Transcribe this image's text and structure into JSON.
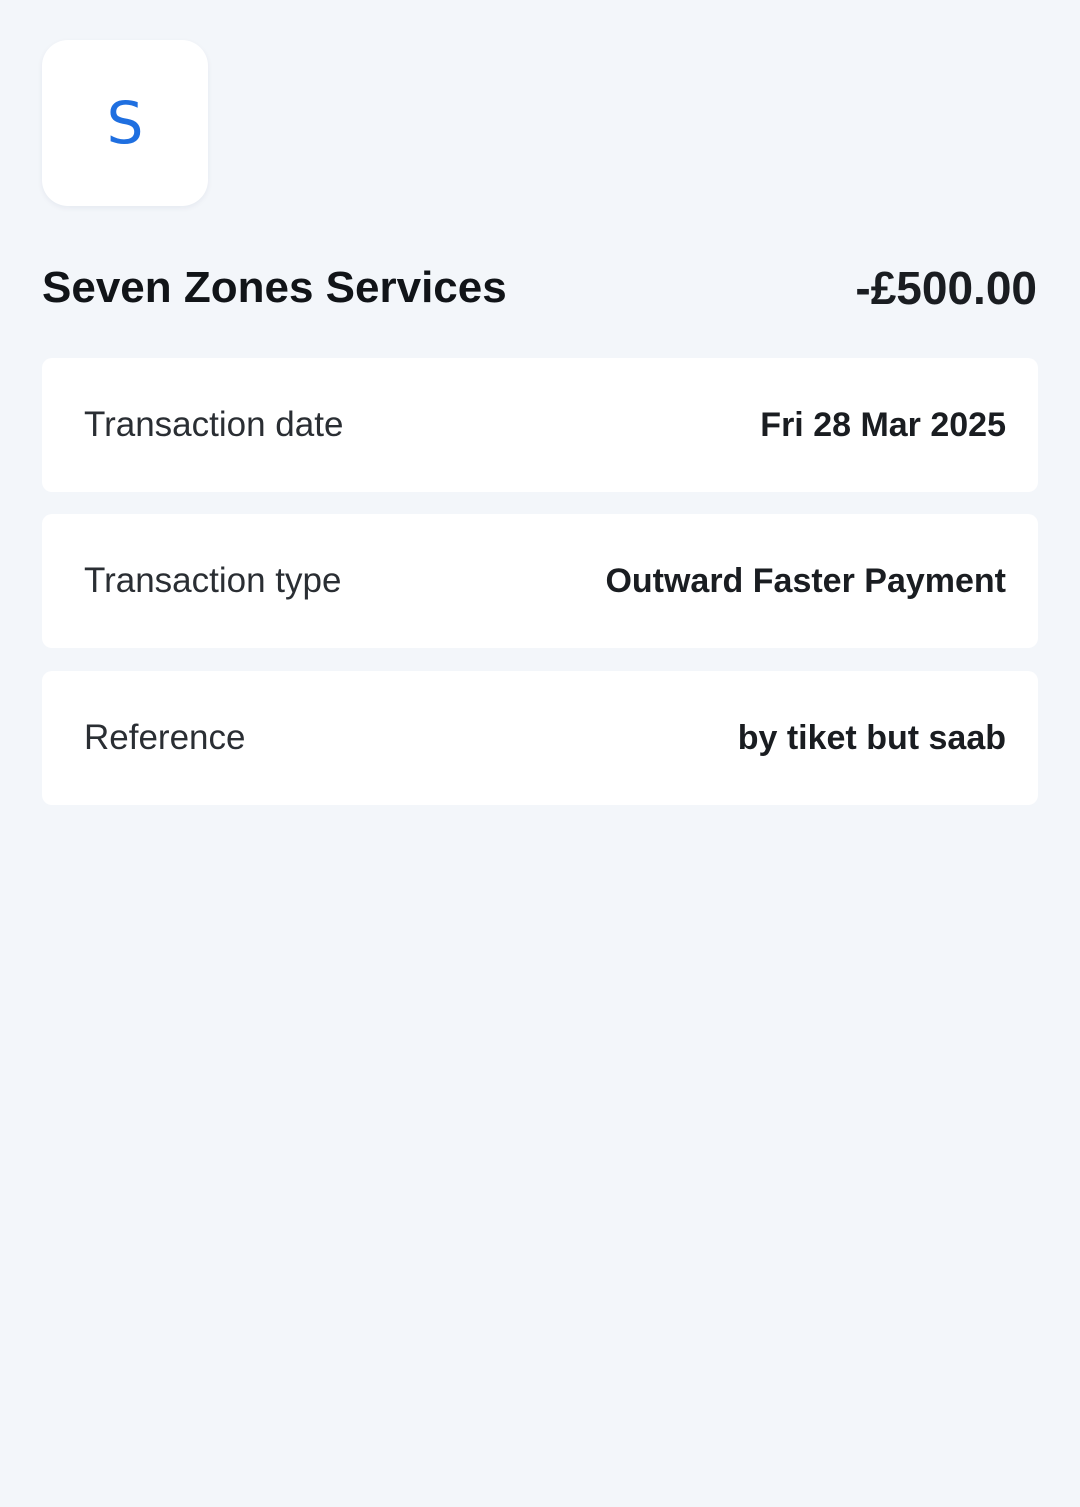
{
  "merchant": {
    "initial": "S",
    "name": "Seven Zones Services",
    "amount": "-£500.00"
  },
  "details": [
    {
      "label": "Transaction date",
      "value": "Fri 28 Mar 2025"
    },
    {
      "label": "Transaction type",
      "value": "Outward Faster Payment"
    },
    {
      "label": "Reference",
      "value": "by tiket but saab"
    }
  ],
  "colors": {
    "background": "#f3f6fa",
    "card": "#ffffff",
    "accent": "#1f6fe0",
    "text": "#1a1d21"
  }
}
